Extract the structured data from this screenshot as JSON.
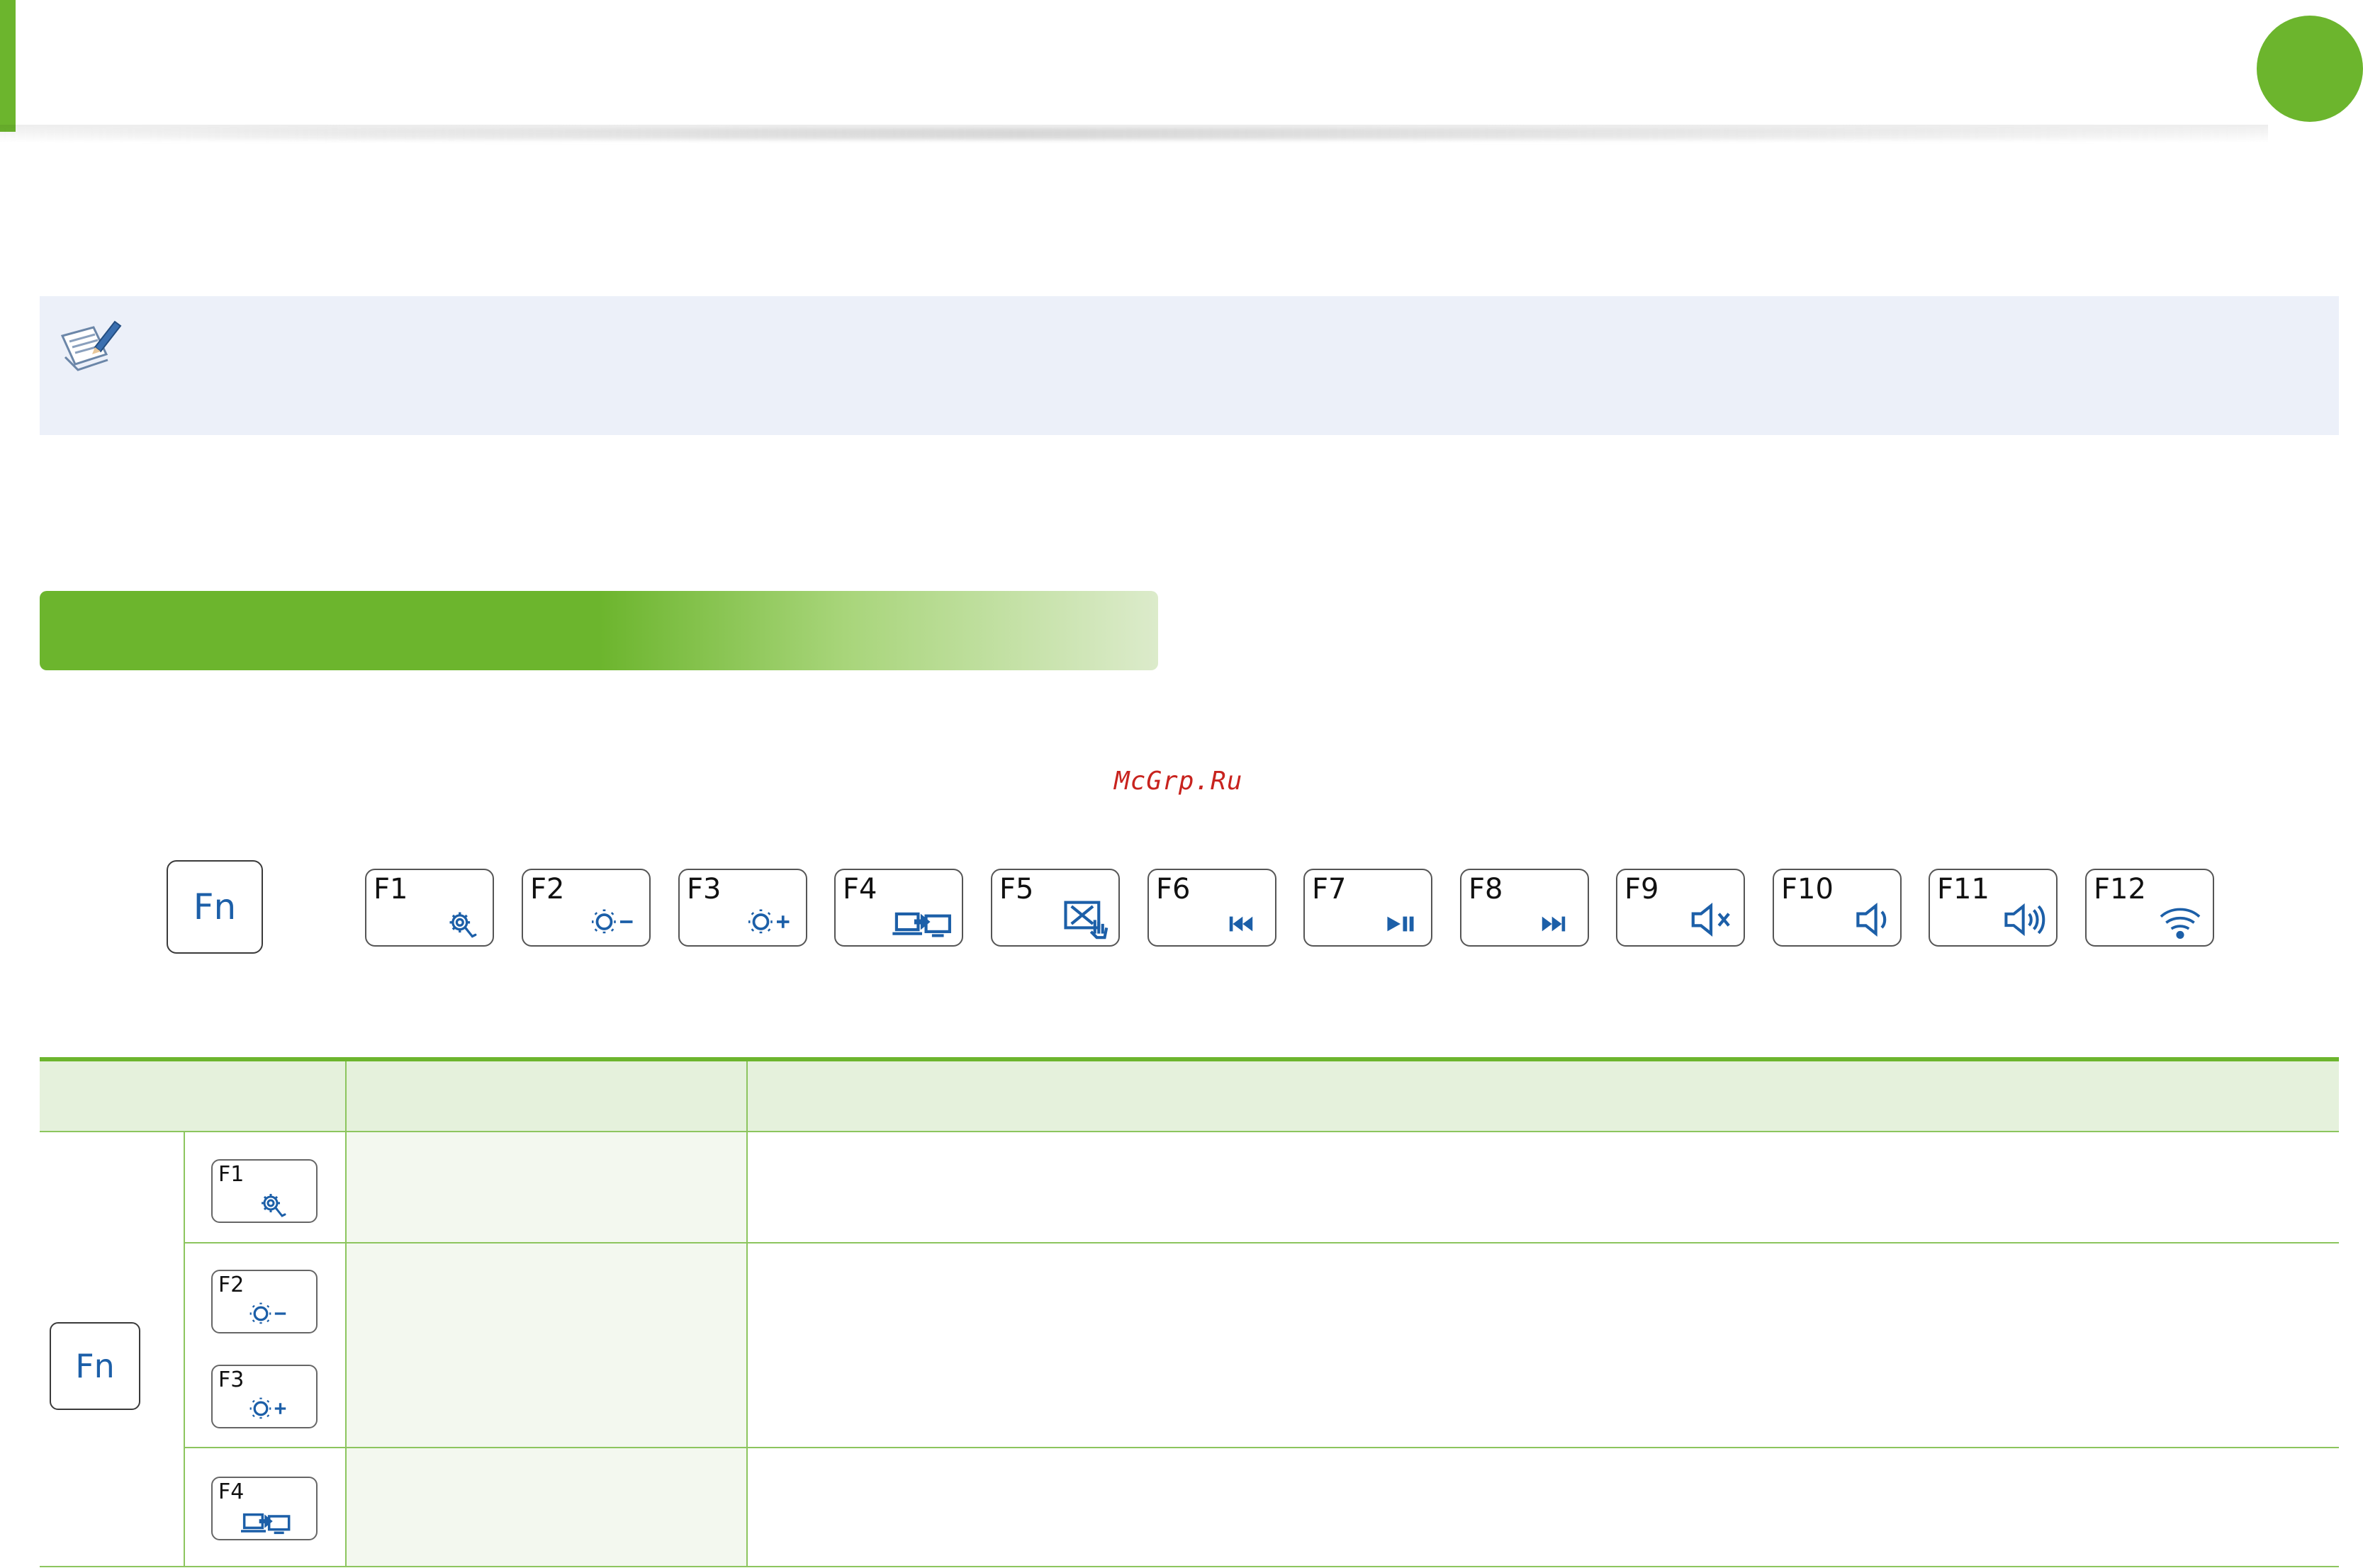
{
  "watermark": "McGrp.Ru",
  "colors": {
    "accent_green": "#6cb52d",
    "key_icon_blue": "#1c5fa8",
    "note_bg": "#ecf0f9",
    "table_header_bg": "#e5f1dc",
    "watermark_red": "#c8231e"
  },
  "fn_key": {
    "label": "Fn"
  },
  "function_keys": [
    {
      "label": "F1",
      "icon": "settings-gear-icon"
    },
    {
      "label": "F2",
      "icon": "brightness-down-icon"
    },
    {
      "label": "F3",
      "icon": "brightness-up-icon"
    },
    {
      "label": "F4",
      "icon": "display-switch-icon"
    },
    {
      "label": "F5",
      "icon": "touchpad-off-icon"
    },
    {
      "label": "F6",
      "icon": "previous-track-icon"
    },
    {
      "label": "F7",
      "icon": "play-pause-icon"
    },
    {
      "label": "F8",
      "icon": "next-track-icon"
    },
    {
      "label": "F9",
      "icon": "mute-icon"
    },
    {
      "label": "F10",
      "icon": "volume-down-icon"
    },
    {
      "label": "F11",
      "icon": "volume-up-icon"
    },
    {
      "label": "F12",
      "icon": "wifi-icon"
    }
  ],
  "table": {
    "fn_label": "Fn",
    "rows": [
      {
        "keys": [
          {
            "label": "F1",
            "icon": "settings-gear-icon"
          }
        ]
      },
      {
        "keys": [
          {
            "label": "F2",
            "icon": "brightness-down-icon"
          },
          {
            "label": "F3",
            "icon": "brightness-up-icon"
          }
        ]
      },
      {
        "keys": [
          {
            "label": "F4",
            "icon": "display-switch-icon"
          }
        ]
      }
    ]
  }
}
